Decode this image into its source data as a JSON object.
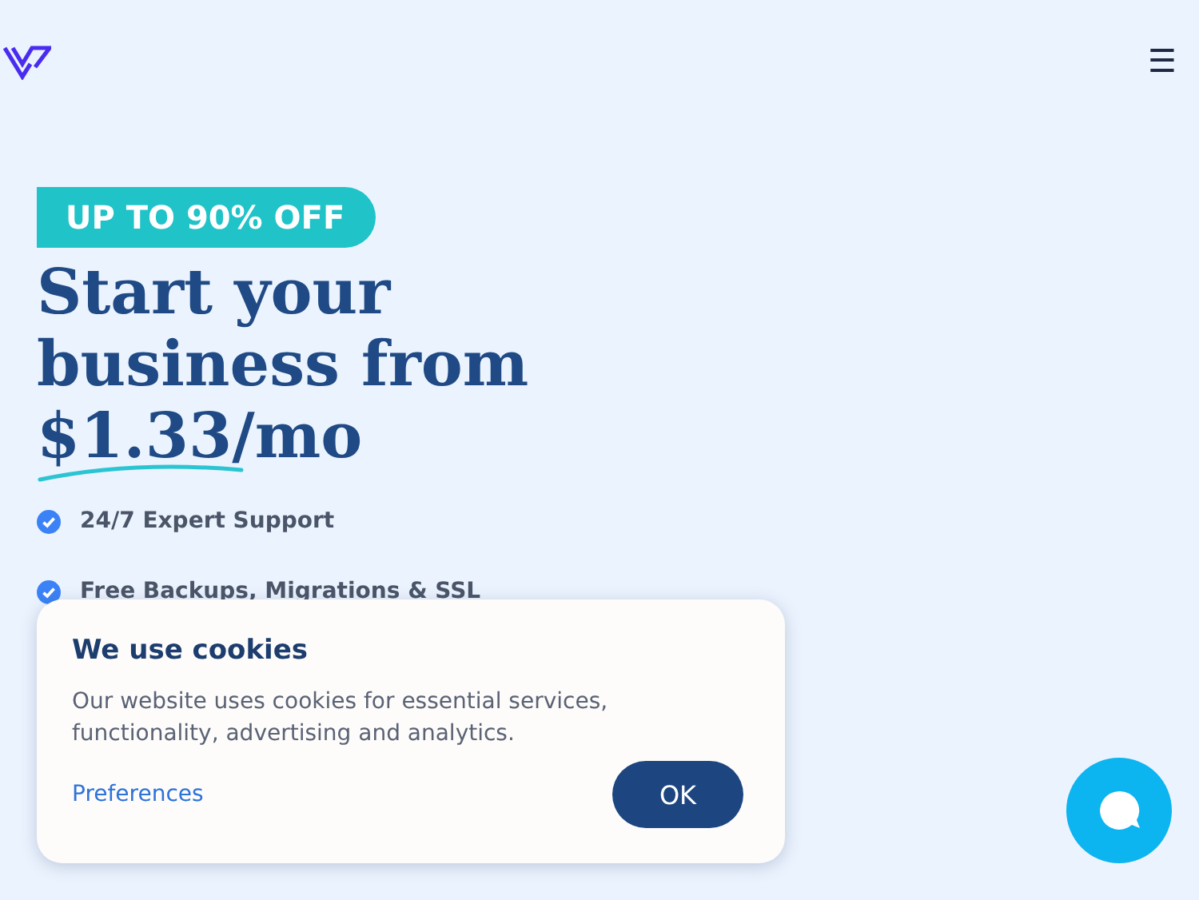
{
  "header": {
    "menu": "☰"
  },
  "hero": {
    "badge": "UP TO 90% OFF",
    "headline": [
      "Start your",
      "business from",
      "$1.33/mo"
    ],
    "features": [
      "24/7 Expert Support",
      "Free Backups, Migrations & SSL"
    ]
  },
  "cookie_banner": {
    "title": "We use cookies",
    "text": "Our website uses cookies for essential services, functionality, advertising and analytics.",
    "link": "Preferences",
    "button": "OK"
  }
}
